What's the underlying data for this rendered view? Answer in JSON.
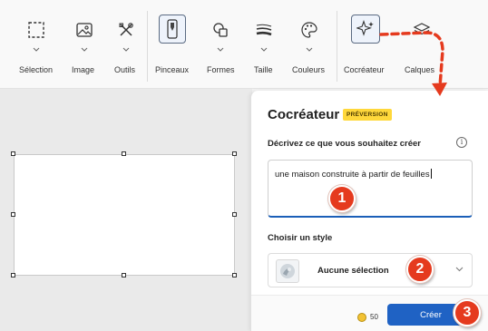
{
  "ribbon": {
    "tools": [
      {
        "id": "selection",
        "label": "Sélection",
        "icon": "selection-icon"
      },
      {
        "id": "image",
        "label": "Image",
        "icon": "image-icon"
      },
      {
        "id": "outils",
        "label": "Outils",
        "icon": "tools-icon"
      },
      {
        "id": "pinceaux",
        "label": "Pinceaux",
        "icon": "brush-icon"
      },
      {
        "id": "formes",
        "label": "Formes",
        "icon": "shapes-icon"
      },
      {
        "id": "taille",
        "label": "Taille",
        "icon": "stroke-size-icon"
      },
      {
        "id": "couleurs",
        "label": "Couleurs",
        "icon": "palette-icon"
      },
      {
        "id": "cocreateur",
        "label": "Cocréateur",
        "icon": "cocreator-sparkle-icon"
      },
      {
        "id": "calques",
        "label": "Calques",
        "icon": "layers-icon"
      }
    ]
  },
  "panel": {
    "title": "Cocréateur",
    "badge": "PRÉVERSION",
    "prompt_label": "Décrivez ce que vous souhaitez créer",
    "prompt_value": "une maison construite à partir de feuilles",
    "style_label": "Choisir un style",
    "style_value": "Aucune sélection",
    "credits": "50",
    "create_label": "Créer"
  },
  "markers": {
    "one": "1",
    "two": "2",
    "three": "3"
  },
  "colors": {
    "accent": "#1f62c4",
    "badge": "#ffd83b",
    "marker": "#e53a1e"
  }
}
